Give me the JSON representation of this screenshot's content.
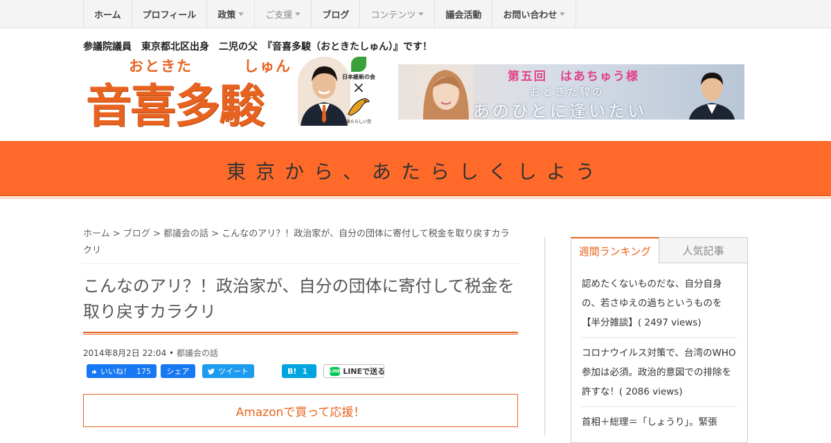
{
  "nav": {
    "items": [
      {
        "label": "ホーム",
        "dropdown": false,
        "muted": false
      },
      {
        "label": "プロフィール",
        "dropdown": false,
        "muted": false
      },
      {
        "label": "政策",
        "dropdown": true,
        "muted": false
      },
      {
        "label": "ご支援",
        "dropdown": true,
        "muted": true
      },
      {
        "label": "ブログ",
        "dropdown": false,
        "muted": false
      },
      {
        "label": "コンテンツ",
        "dropdown": true,
        "muted": true
      },
      {
        "label": "議会活動",
        "dropdown": false,
        "muted": false
      },
      {
        "label": "お問い合わせ",
        "dropdown": true,
        "muted": false
      }
    ]
  },
  "header": {
    "tagline": "参議院議員　東京都北区出身　二児の父　『音喜多駿（おときたしゅん）』です！",
    "logo": {
      "ruby_left": "おときた",
      "ruby_right": "しゅん",
      "name": "音喜多駿",
      "party": "日本維新の会",
      "times": "×",
      "partner": "あたらしい党"
    },
    "banner": {
      "title": "第五回　はあちゅう様",
      "subtitle": "おときた駿の",
      "main": "あのひとに逢いたい"
    }
  },
  "slogan": "東京から、あたらしくしよう",
  "breadcrumb": {
    "home": "ホーム",
    "blog": "ブログ",
    "category": "都議会の話",
    "separator": ">",
    "current": "こんなのアリ？！政治家が、自分の団体に寄付して税金を取り戻すカラクリ"
  },
  "article": {
    "title": "こんなのアリ？！政治家が、自分の団体に寄付して税金を取り戻すカラクリ",
    "date": "2014年8月2日 22:04",
    "bullet": "•",
    "category": "都議会の話"
  },
  "share": {
    "fb_like_label": "いいね！",
    "fb_like_count": "175",
    "fb_share_label": "シェア",
    "tweet_label": "ツイート",
    "hatena_label": "B!",
    "hatena_count": "1",
    "line_label": "LINEで送る",
    "line_badge": "LINE"
  },
  "amazon_label": "Amazonで買って応援！",
  "sidebar": {
    "tabs": [
      "週間ランキング",
      "人気記事"
    ],
    "ranking": [
      "認めたくないものだな、自分自身の、若さゆえの過ちというものを【半分雑談】( 2497 views)",
      "コロナウイルス対策で、台湾のWHO参加は必須。政治的意図での排除を許すな！( 2086 views)",
      "首相＋総理＝「しょうり」。緊張"
    ]
  },
  "colors": {
    "accent": "#e8631f",
    "band": "#ff6a2a",
    "facebook": "#1877f2",
    "twitter": "#1d9bf0",
    "hatena": "#00a4de",
    "line": "#06c755"
  }
}
